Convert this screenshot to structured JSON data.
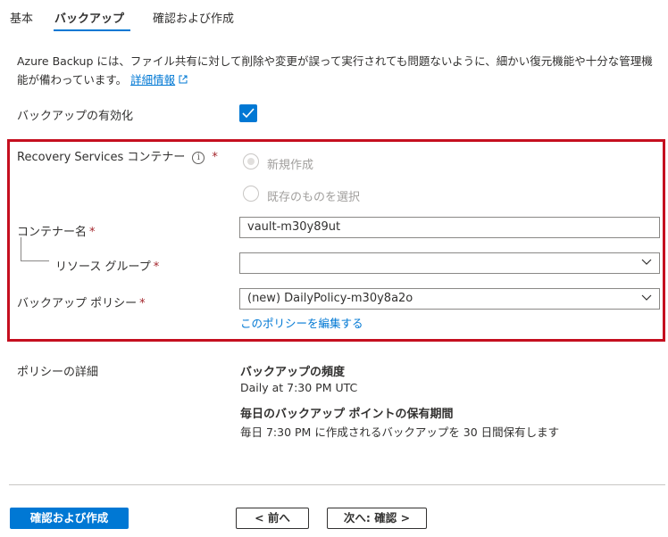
{
  "tabs": [
    {
      "label": "基本"
    },
    {
      "label": "バックアップ"
    },
    {
      "label": "確認および作成"
    }
  ],
  "description": {
    "text": "Azure Backup には、ファイル共有に対して削除や変更が誤って実行されても問題ないように、細かい復元機能や十分な管理機能が備わっています。",
    "link": "詳細情報",
    "link_icon": "external-link-icon"
  },
  "backup_enable": {
    "label": "バックアップの有効化",
    "checked": true
  },
  "vault": {
    "label": "Recovery Services コンテナー",
    "info_glyph": "i",
    "required": "*",
    "options": [
      "新規作成",
      "既存のものを選択"
    ],
    "selected": "新規作成",
    "name_label": "コンテナー名",
    "name_value": "vault-m30y89ut",
    "resource_group_label": "リソース グループ",
    "resource_group_value": "",
    "policy_label": "バックアップ ポリシー",
    "policy_value": "(new) DailyPolicy-m30y8a2o",
    "edit_policy_link": "このポリシーを編集する"
  },
  "policy_details": {
    "label": "ポリシーの詳細",
    "frequency_title": "バックアップの頻度",
    "frequency_value": "Daily at 7:30 PM UTC",
    "retention_title": "毎日のバックアップ ポイントの保有期間",
    "retention_value": "毎日 7:30 PM に作成されるバックアップを 30 日間保有します"
  },
  "footer": {
    "review_create": "確認および作成",
    "previous": "< 前へ",
    "next": "次へ: 確認 >"
  },
  "colors": {
    "accent": "#0078d4",
    "highlight_border": "#c50f1f",
    "required": "#a4262c"
  }
}
